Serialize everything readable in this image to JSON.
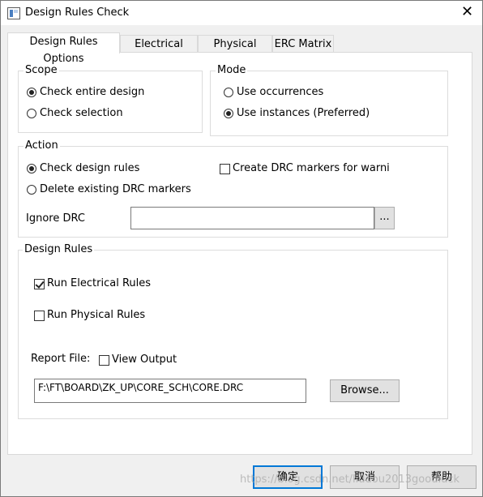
{
  "window": {
    "title": "Design Rules Check",
    "close_glyph": "✕"
  },
  "tabs": [
    {
      "label": "Design Rules Options",
      "active": true
    },
    {
      "label": "Electrical Rules",
      "active": false
    },
    {
      "label": "Physical Rules",
      "active": false
    },
    {
      "label": "ERC Matrix",
      "active": false
    }
  ],
  "scope": {
    "label": "Scope",
    "options": [
      {
        "label": "Check entire design",
        "selected": true
      },
      {
        "label": "Check selection",
        "selected": false
      }
    ]
  },
  "mode": {
    "label": "Mode",
    "options": [
      {
        "label": "Use occurrences",
        "selected": false
      },
      {
        "label": "Use instances (Preferred)",
        "selected": true
      }
    ]
  },
  "action": {
    "label": "Action",
    "options": [
      {
        "label": "Check design rules",
        "selected": true
      },
      {
        "label": "Delete existing DRC markers",
        "selected": false
      }
    ],
    "create_markers": {
      "label": "Create DRC markers for warnings",
      "checked": false
    },
    "ignore_drc": {
      "label": "Ignore DRC",
      "value": "",
      "browse_label": "..."
    }
  },
  "design_rules": {
    "label": "Design Rules",
    "run_electrical": {
      "label": "Run Electrical Rules",
      "checked": true
    },
    "run_physical": {
      "label": "Run Physical Rules",
      "checked": false
    },
    "report_file_label": "Report File:",
    "view_output": {
      "label": "View Output",
      "checked": false
    },
    "report_path": "F:\\FT\\BOARD\\ZK_UP\\CORE_SCH\\CORE.DRC",
    "browse_label": "Browse..."
  },
  "footer": {
    "ok_label": "确定",
    "cancel_label": "取消",
    "help_label": "帮助"
  },
  "watermark": "https://blog.csdn.net/liudou2013goodluck",
  "colors": {
    "accent": "#0078d7",
    "panel_bg": "#ffffff",
    "window_bg": "#f0f0f0"
  }
}
